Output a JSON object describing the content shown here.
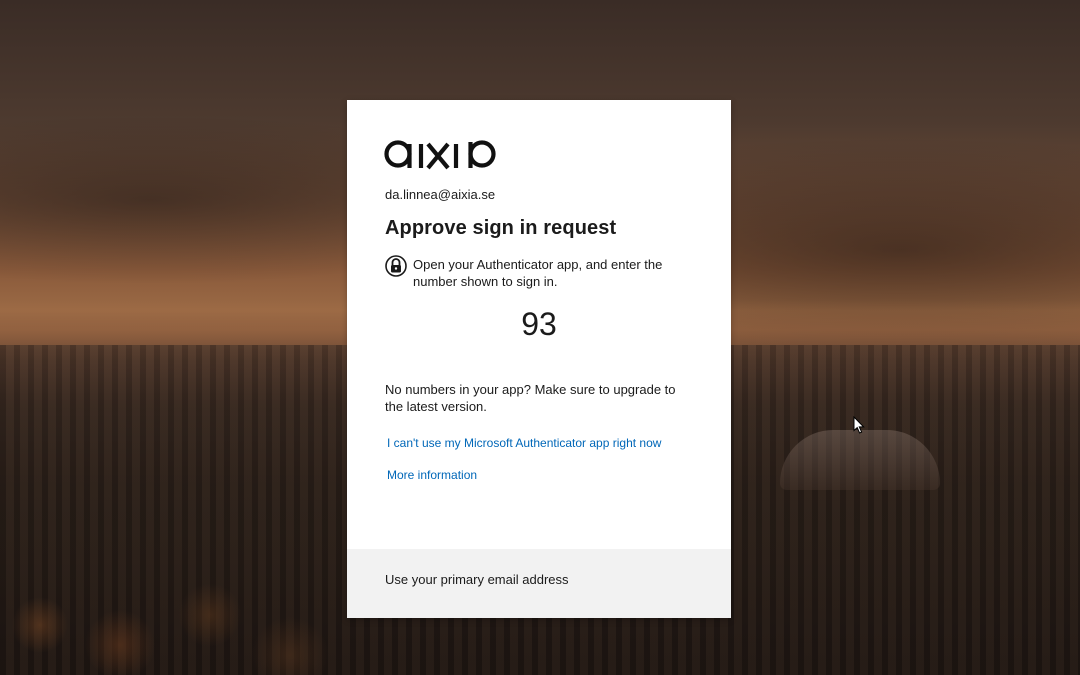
{
  "brand": {
    "logo_text": "aixio"
  },
  "account": {
    "email": "da.linnea@aixia.se"
  },
  "main": {
    "title": "Approve sign in request",
    "instruction": "Open your Authenticator app, and enter the number shown to sign in.",
    "number": "93",
    "upgrade_note": "No numbers in your app? Make sure to upgrade to the latest version.",
    "link_cant_use": "I can't use my Microsoft Authenticator app right now",
    "link_more_info": "More information"
  },
  "footer": {
    "option": "Use your primary email address"
  },
  "colors": {
    "link": "#0067b8",
    "text": "#1b1b1b",
    "footer_bg": "#f2f2f2"
  },
  "icons": {
    "instruction": "authenticator-lock-icon",
    "cursor": "mouse-pointer-icon"
  }
}
